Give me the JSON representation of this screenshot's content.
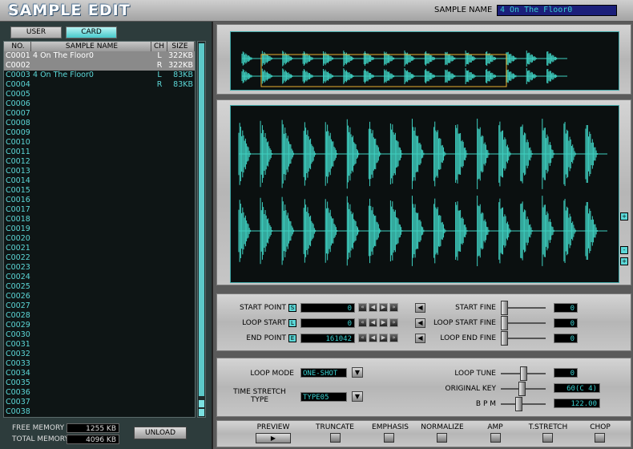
{
  "title": "SAMPLE EDIT",
  "sample_name": {
    "label": "SAMPLE NAME",
    "value": "4 On The Floor0"
  },
  "tabs": {
    "user": "USER",
    "card": "CARD"
  },
  "list": {
    "headers": {
      "no": "NO.",
      "name": "SAMPLE NAME",
      "ch": "CH",
      "size": "SIZE"
    },
    "rows": [
      {
        "no": "C0001",
        "name": "4 On The Floor0",
        "ch": "L",
        "size": "322KB",
        "selected": true
      },
      {
        "no": "C0002",
        "name": "",
        "ch": "R",
        "size": "322KB",
        "selected": true
      },
      {
        "no": "C0003",
        "name": "4 On The Floor0",
        "ch": "L",
        "size": "83KB",
        "selected": false
      },
      {
        "no": "C0004",
        "name": "",
        "ch": "R",
        "size": "83KB",
        "selected": false
      },
      {
        "no": "C0005"
      },
      {
        "no": "C0006"
      },
      {
        "no": "C0007"
      },
      {
        "no": "C0008"
      },
      {
        "no": "C0009"
      },
      {
        "no": "C0010"
      },
      {
        "no": "C0011"
      },
      {
        "no": "C0012"
      },
      {
        "no": "C0013"
      },
      {
        "no": "C0014"
      },
      {
        "no": "C0015"
      },
      {
        "no": "C0016"
      },
      {
        "no": "C0017"
      },
      {
        "no": "C0018"
      },
      {
        "no": "C0019"
      },
      {
        "no": "C0020"
      },
      {
        "no": "C0021"
      },
      {
        "no": "C0022"
      },
      {
        "no": "C0023"
      },
      {
        "no": "C0024"
      },
      {
        "no": "C0025"
      },
      {
        "no": "C0026"
      },
      {
        "no": "C0027"
      },
      {
        "no": "C0028"
      },
      {
        "no": "C0029"
      },
      {
        "no": "C0030"
      },
      {
        "no": "C0031"
      },
      {
        "no": "C0032"
      },
      {
        "no": "C0033"
      },
      {
        "no": "C0034"
      },
      {
        "no": "C0035"
      },
      {
        "no": "C0036"
      },
      {
        "no": "C0037"
      },
      {
        "no": "C0038"
      }
    ]
  },
  "memory": {
    "free_label": "FREE MEMORY",
    "free_value": "1255 KB",
    "total_label": "TOTAL MEMORY",
    "total_value": "4096 KB"
  },
  "unload_label": "UNLOAD",
  "points": {
    "start_point_label": "START POINT",
    "start_point_value": "0",
    "loop_start_label": "LOOP START",
    "loop_start_value": "0",
    "end_point_label": "END POINT",
    "end_point_value": "161042",
    "start_fine_label": "START FINE",
    "start_fine_value": "0",
    "loop_start_fine_label": "LOOP START FINE",
    "loop_start_fine_value": "0",
    "loop_end_fine_label": "LOOP END FINE",
    "loop_end_fine_value": "0"
  },
  "loop": {
    "loop_mode_label": "LOOP MODE",
    "loop_mode_value": "ONE-SHOT",
    "time_stretch_label_1": "TIME STRETCH",
    "time_stretch_label_2": "TYPE",
    "time_stretch_value": "TYPE05",
    "loop_tune_label": "LOOP TUNE",
    "loop_tune_value": "0",
    "original_key_label": "ORIGINAL KEY",
    "original_key_value": "60(C 4)",
    "bpm_label": "B P M",
    "bpm_value": "122.00"
  },
  "buttons": {
    "preview": "PREVIEW",
    "truncate": "TRUNCATE",
    "emphasis": "EMPHASIS",
    "normalize": "NORMALIZE",
    "amp": "AMP",
    "tstretch": "T.STRETCH",
    "chop": "CHOP"
  },
  "colors": {
    "wave": "#3ecfc0",
    "accent": "#5cd8d8",
    "marker": "#e8b030"
  }
}
